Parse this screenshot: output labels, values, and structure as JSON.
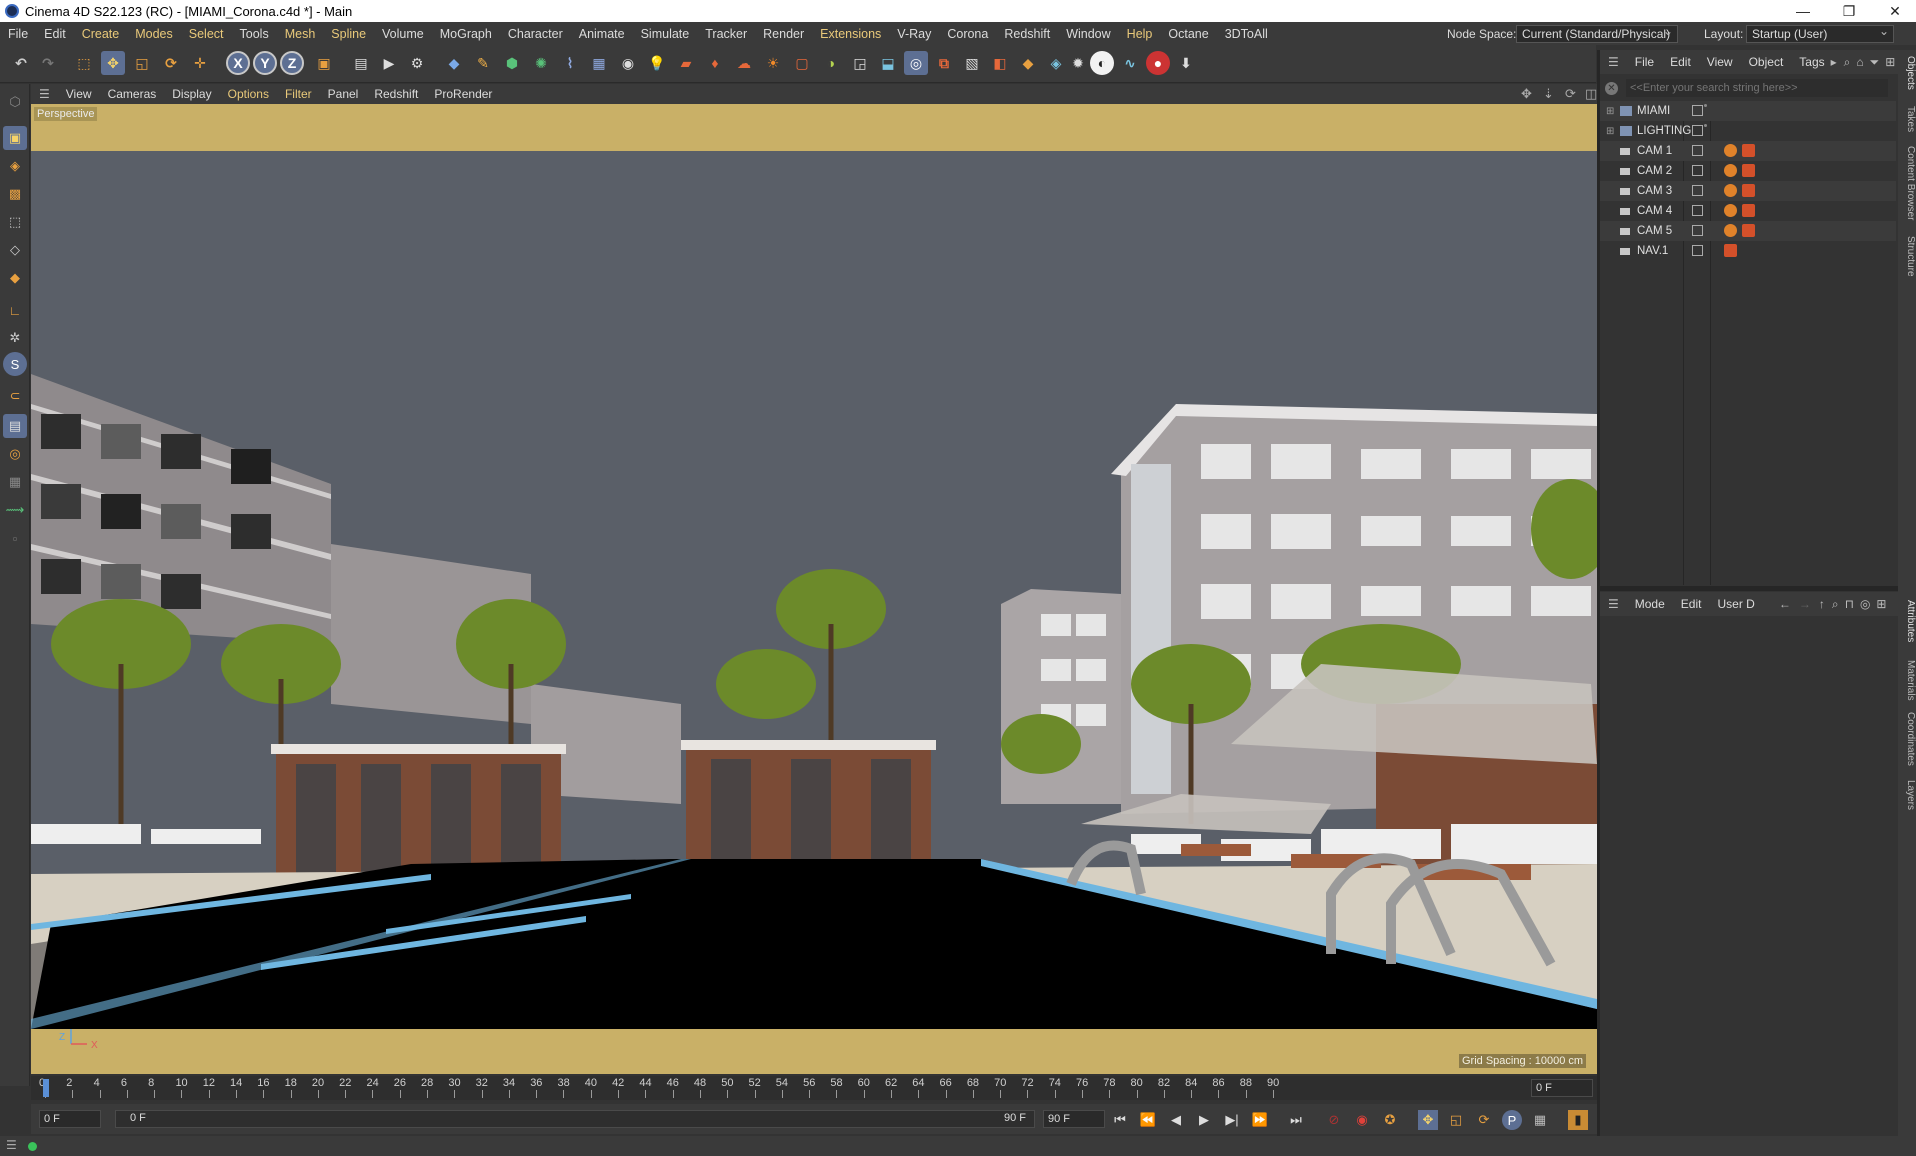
{
  "window": {
    "title": "Cinema 4D S22.123 (RC) - [MIAMI_Corona.c4d *] - Main",
    "controls": [
      "—",
      "❐",
      "✕"
    ]
  },
  "menubar": {
    "items": [
      "File",
      "Edit",
      "Create",
      "Modes",
      "Select",
      "Tools",
      "Mesh",
      "Spline",
      "Volume",
      "MoGraph",
      "Character",
      "Animate",
      "Simulate",
      "Tracker",
      "Render",
      "Extensions",
      "V-Ray",
      "Corona",
      "Redshift",
      "Window",
      "Help",
      "Octane",
      "3DToAll"
    ],
    "node_space_label": "Node Space:",
    "node_space_value": "Current (Standard/Physical)",
    "layout_label": "Layout:",
    "layout_value": "Startup (User)"
  },
  "toolbar": {
    "axis_x": "X",
    "axis_y": "Y",
    "axis_z": "Z"
  },
  "viewport": {
    "menu": [
      "View",
      "Cameras",
      "Display",
      "Options",
      "Filter",
      "Panel",
      "Redshift",
      "ProRender"
    ],
    "label": "Perspective",
    "grid_spacing": "Grid Spacing : 10000 cm",
    "axis_z": "Z",
    "axis_x": "X"
  },
  "timeline": {
    "ticks": [
      "0",
      "2",
      "4",
      "6",
      "8",
      "10",
      "12",
      "14",
      "16",
      "18",
      "20",
      "22",
      "24",
      "26",
      "28",
      "30",
      "32",
      "34",
      "36",
      "38",
      "40",
      "42",
      "44",
      "46",
      "48",
      "50",
      "52",
      "54",
      "56",
      "58",
      "60",
      "62",
      "64",
      "66",
      "68",
      "70",
      "72",
      "74",
      "76",
      "78",
      "80",
      "82",
      "84",
      "86",
      "88",
      "90"
    ],
    "current_frame": "0 F",
    "start_frame": "0 F",
    "range_start": "0 F",
    "range_end": "90 F",
    "end_frame": "90 F"
  },
  "objects_panel": {
    "menu": [
      "File",
      "Edit",
      "View",
      "Object",
      "Tags"
    ],
    "search_placeholder": "<<Enter your search string here>>",
    "objects": [
      {
        "name": "MIAMI",
        "type": "layer"
      },
      {
        "name": "LIGHTING",
        "type": "layer"
      },
      {
        "name": "CAM 1",
        "type": "camera"
      },
      {
        "name": "CAM 2",
        "type": "camera"
      },
      {
        "name": "CAM 3",
        "type": "camera"
      },
      {
        "name": "CAM 4",
        "type": "camera"
      },
      {
        "name": "CAM 5",
        "type": "camera"
      },
      {
        "name": "NAV.1",
        "type": "camera"
      }
    ]
  },
  "attributes_panel": {
    "menu": [
      "Mode",
      "Edit",
      "User D"
    ]
  },
  "side_tabs": {
    "top": [
      "Objects",
      "Takes",
      "Content Browser",
      "Structure"
    ],
    "bottom": [
      "Attributes",
      "Materials",
      "Coordinates",
      "Layers"
    ]
  },
  "colors": {
    "ui_bg": "#3a3a3a",
    "highlight_menu": "#e9c97a",
    "viewport_bg": "#c9b067",
    "sky": "#5a5f68"
  }
}
